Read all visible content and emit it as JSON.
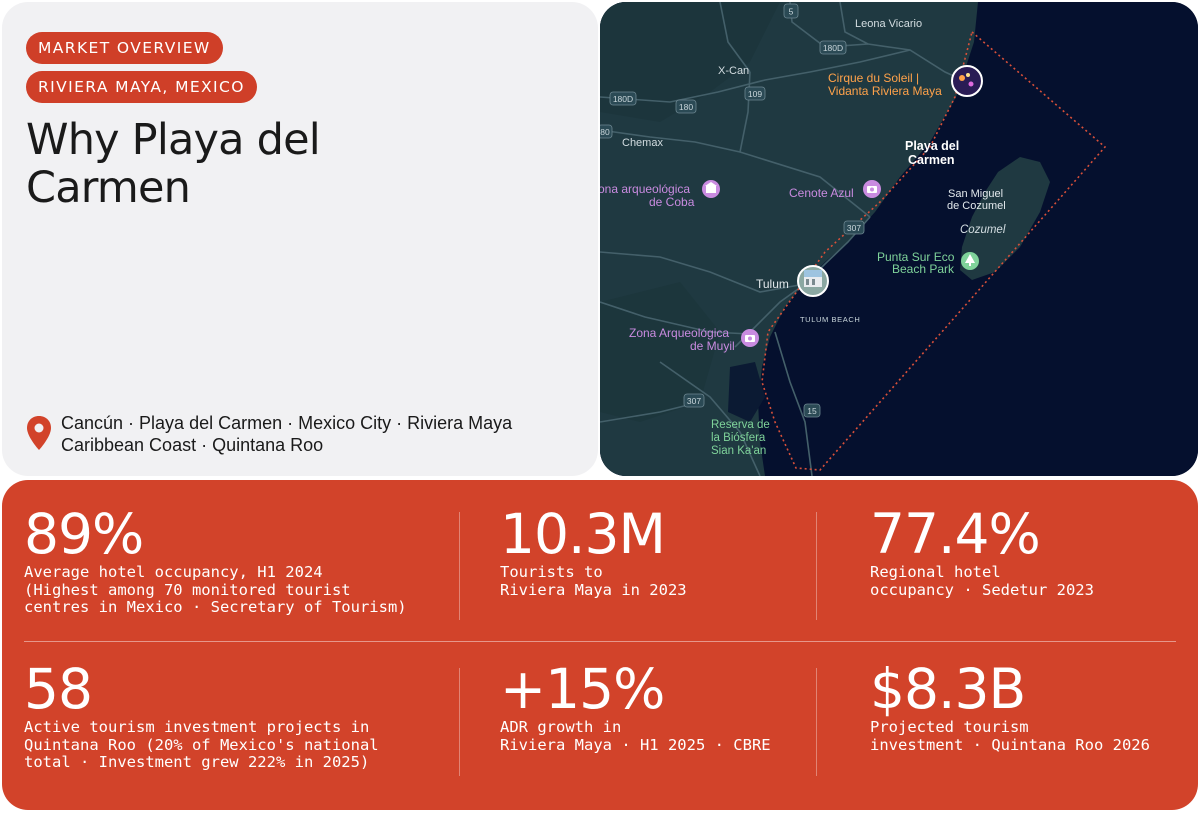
{
  "header": {
    "tag_primary": "MARKET OVERVIEW",
    "tag_secondary": "RIVIERA MAYA, MEXICO",
    "title": "Why Playa del Carmen"
  },
  "locations": {
    "line1": "Cancún · Playa del Carmen · Mexico City · Riviera Maya",
    "line2": "Caribbean Coast · Quintana Roo",
    "icon": "location-pin-icon"
  },
  "map": {
    "places": {
      "leona_vicario": "Leona Vicario",
      "x_can": "X-Can",
      "chemax": "Chemax",
      "playa_line1": "Playa del",
      "playa_line2": "Carmen",
      "cirque_line1": "Cirque du Soleil |",
      "cirque_line2": "Vidanta Riviera Maya",
      "coba_line1": "ona arqueológica",
      "coba_line2": "de Coba",
      "cenote": "Cenote Azul",
      "san_miguel_line1": "San Miguel",
      "san_miguel_line2": "de Cozumel",
      "cozumel": "Cozumel",
      "punta_sur_line1": "Punta Sur Eco",
      "punta_sur_line2": "Beach Park",
      "tulum": "Tulum",
      "tulum_beach": "TULUM BEACH",
      "muyil_line1": "Zona Arqueológica",
      "muyil_line2": "de Muyil",
      "reserva_line1": "Reserva de",
      "reserva_line2": "la Biósfera",
      "reserva_line3": "Sian Ka'an"
    },
    "road_shields": {
      "r5": "5",
      "r180d_a": "180D",
      "r180d_b": "180D",
      "r180": "180",
      "r109": "109",
      "r80": "80",
      "r307_a": "307",
      "r307_b": "307",
      "r15": "15"
    },
    "colors": {
      "land": "#1f3941",
      "sea": "#05102e",
      "road": "#44606a",
      "boundary": "#d9503a",
      "poi_purple": "#c98be0",
      "poi_orange": "#ffa24a",
      "poi_green": "#7fd39a"
    }
  },
  "stats": {
    "occupancy": {
      "value": "89%",
      "label": "Average hotel occupancy, H1 2024\n(Highest among 70 monitored tourist\ncentres in Mexico · Secretary of Tourism)"
    },
    "tourists": {
      "value": "10.3M",
      "label": "Tourists to\nRiviera Maya in 2023"
    },
    "regional": {
      "value": "77.4%",
      "label": "Regional hotel\noccupancy · Sedetur 2023"
    },
    "projects": {
      "value": "58",
      "label": "Active tourism investment projects in\nQuintana Roo (20% of Mexico's national\ntotal · Investment grew 222% in 2025)"
    },
    "adr": {
      "value": "+15%",
      "label": "ADR growth in\nRiviera Maya · H1 2025 · CBRE"
    },
    "investment": {
      "value": "$8.3B",
      "label": "Projected tourism\ninvestment · Quintana Roo 2026"
    }
  },
  "theme": {
    "accent": "#d2432a",
    "card_bg": "#f1f1f3",
    "text_dark": "#1a1a1a"
  }
}
